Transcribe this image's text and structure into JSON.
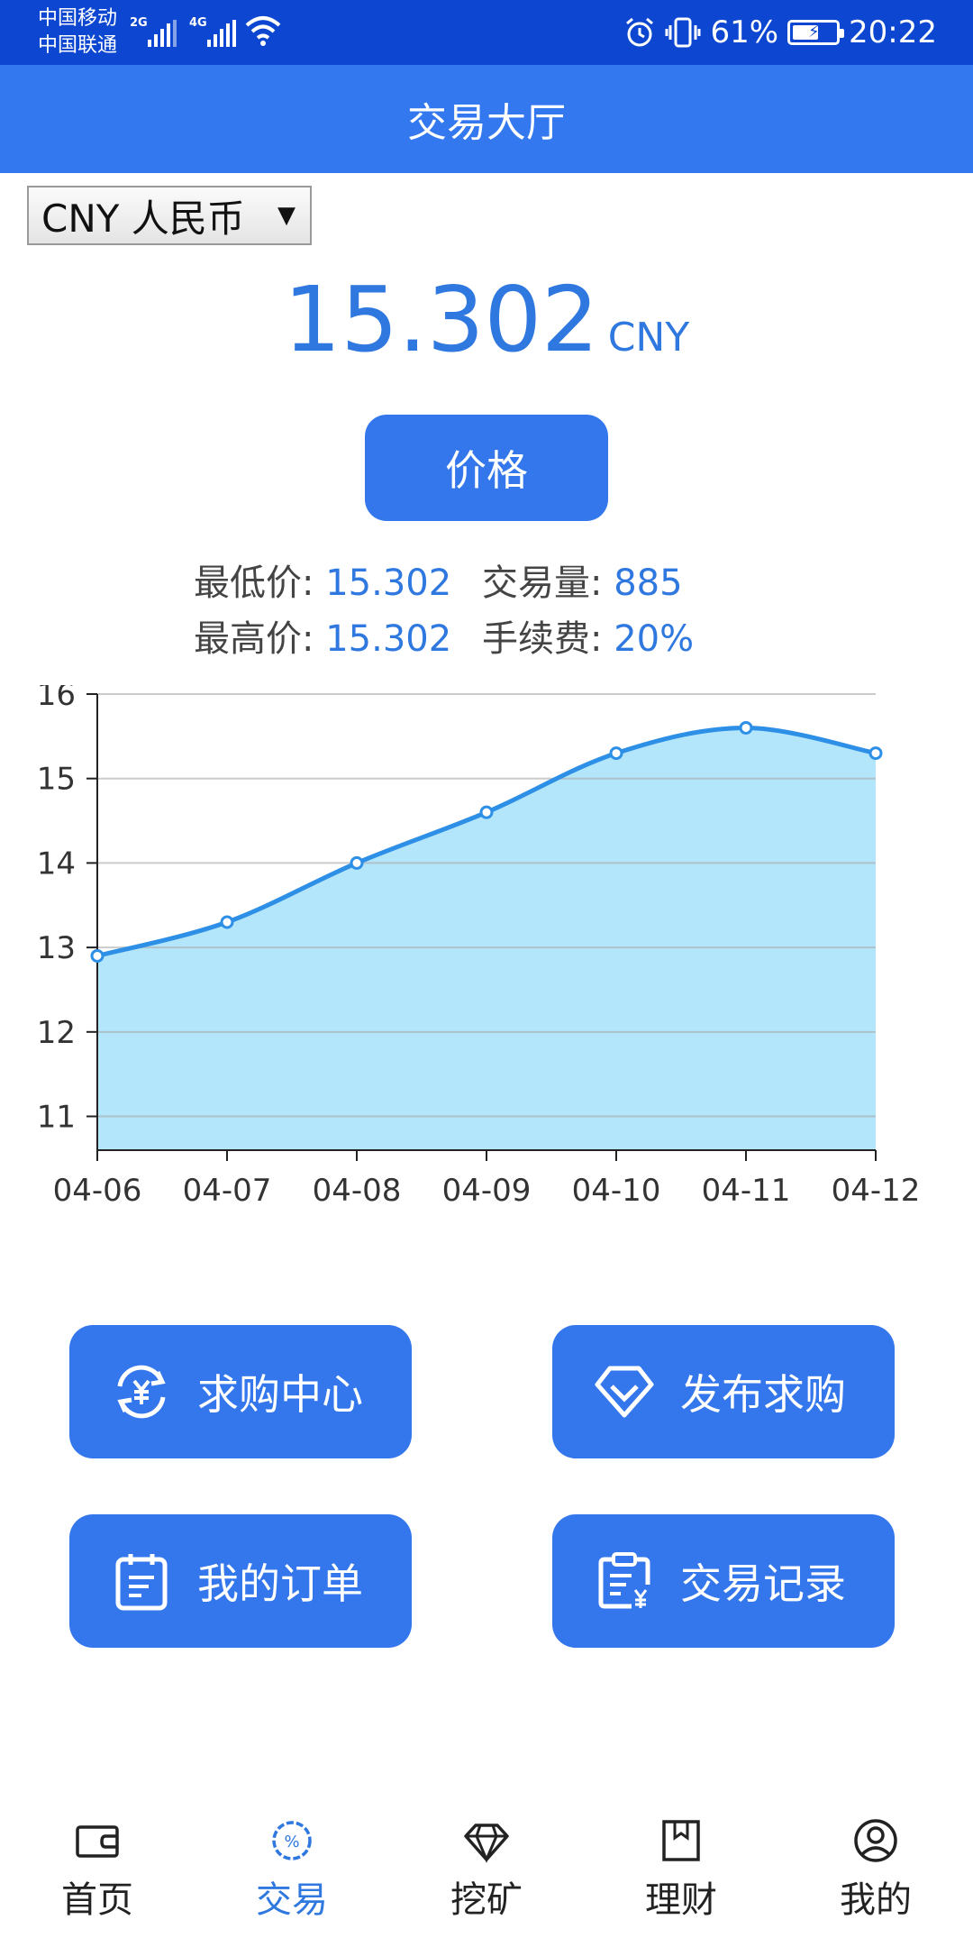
{
  "status_bar": {
    "carrier1": "中国移动",
    "carrier2": "中国联通",
    "signal1_gen": "2G",
    "signal2_gen": "4G",
    "battery_percent": "61%",
    "battery_level": 0.61,
    "time": "20:22"
  },
  "header": {
    "title": "交易大厅"
  },
  "currency": {
    "selected": "CNY 人民币",
    "caret": "▼"
  },
  "price": {
    "value": "15.302",
    "unit": "CNY"
  },
  "price_button": {
    "label": "价格"
  },
  "stats": {
    "low_label": "最低价: ",
    "low_value": "15.302",
    "volume_label": "交易量: ",
    "volume_value": "885",
    "high_label": "最高价: ",
    "high_value": "15.302",
    "fee_label": "手续费: ",
    "fee_value": "20%"
  },
  "chart_data": {
    "type": "area",
    "categories": [
      "04-06",
      "04-07",
      "04-08",
      "04-09",
      "04-10",
      "04-11",
      "04-12"
    ],
    "values": [
      12.9,
      13.3,
      14.0,
      14.6,
      15.3,
      15.6,
      15.3
    ],
    "ylim": [
      10.6,
      16
    ],
    "yticks": [
      11,
      12,
      13,
      14,
      15,
      16
    ],
    "grid": true,
    "title": "",
    "xlabel": "",
    "ylabel": "",
    "line_color": "#2d8fe6",
    "fill_color": "#b3e5fb"
  },
  "actions": {
    "buy_center": "求购中心",
    "publish_buy": "发布求购",
    "my_orders": "我的订单",
    "trade_records": "交易记录"
  },
  "nav": {
    "home": "首页",
    "trade": "交易",
    "mining": "挖矿",
    "finance": "理财",
    "mine": "我的",
    "active": "trade"
  },
  "colors": {
    "primary": "#3477ed",
    "status_bar": "#0d47d1",
    "accent_text": "#2f78e0"
  }
}
